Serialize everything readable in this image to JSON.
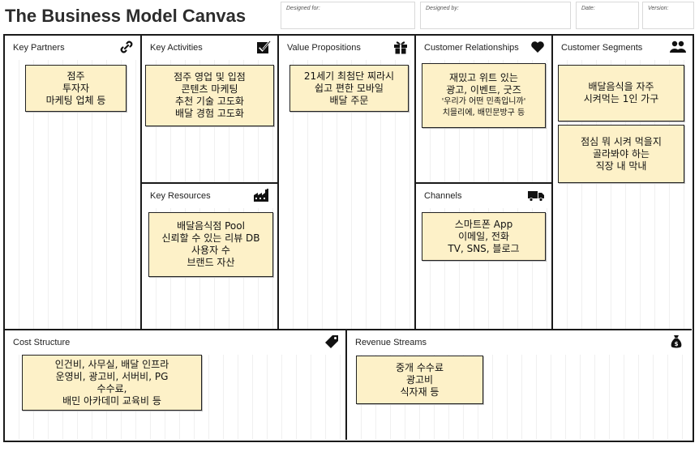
{
  "header": {
    "title": "The Business Model Canvas",
    "designed_for_label": "Designed for:",
    "designed_by_label": "Designed by:",
    "date_label": "Date:",
    "version_label": "Version:"
  },
  "blocks": {
    "key_partners": {
      "title": "Key Partners",
      "icon": "link-icon",
      "notes": [
        [
          "점주",
          "투자자",
          "마케팅 업체 등"
        ]
      ]
    },
    "key_activities": {
      "title": "Key Activities",
      "icon": "checkbox-icon",
      "notes": [
        [
          "점주 영업 및 입점",
          "콘텐츠 마케팅",
          "추천 기술 고도화",
          "배달 경험 고도화"
        ]
      ]
    },
    "key_resources": {
      "title": "Key Resources",
      "icon": "factory-icon",
      "notes": [
        [
          "배달음식점 Pool",
          "신뢰할 수 있는 리뷰 DB",
          "사용자 수",
          "브랜드 자산"
        ]
      ]
    },
    "value_propositions": {
      "title": "Value Propositions",
      "icon": "gift-icon",
      "notes": [
        [
          "21세기 최첨단 찌라시",
          "쉽고 편한 모바일",
          "배달 주문"
        ]
      ]
    },
    "customer_relationships": {
      "title": "Customer Relationships",
      "icon": "heart-icon",
      "notes": [
        [
          "재밌고 위트 있는",
          "광고, 이벤트, 굿즈",
          "'우리가 어떤 민족입니까'",
          "치믈리에, 배민문방구 등"
        ]
      ]
    },
    "channels": {
      "title": "Channels",
      "icon": "truck-icon",
      "notes": [
        [
          "스마트폰 App",
          "이메일, 전화",
          "TV, SNS, 블로그"
        ]
      ]
    },
    "customer_segments": {
      "title": "Customer Segments",
      "icon": "people-icon",
      "notes": [
        [
          "배달음식을 자주",
          "시켜먹는 1인 가구"
        ],
        [
          "점심 뭐 시켜 먹을지",
          "골라봐야 하는",
          "직장 내 막내"
        ]
      ]
    },
    "cost_structure": {
      "title": "Cost Structure",
      "icon": "tag-icon",
      "notes": [
        [
          "인건비, 사무실, 배달 인프라",
          "운영비, 광고비, 서버비, PG",
          "수수료,",
          "배민 아카데미 교육비 등"
        ]
      ]
    },
    "revenue_streams": {
      "title": "Revenue Streams",
      "icon": "money-bag-icon",
      "notes": [
        [
          "중개 수수료",
          "광고비",
          "식자재 등"
        ]
      ]
    }
  }
}
